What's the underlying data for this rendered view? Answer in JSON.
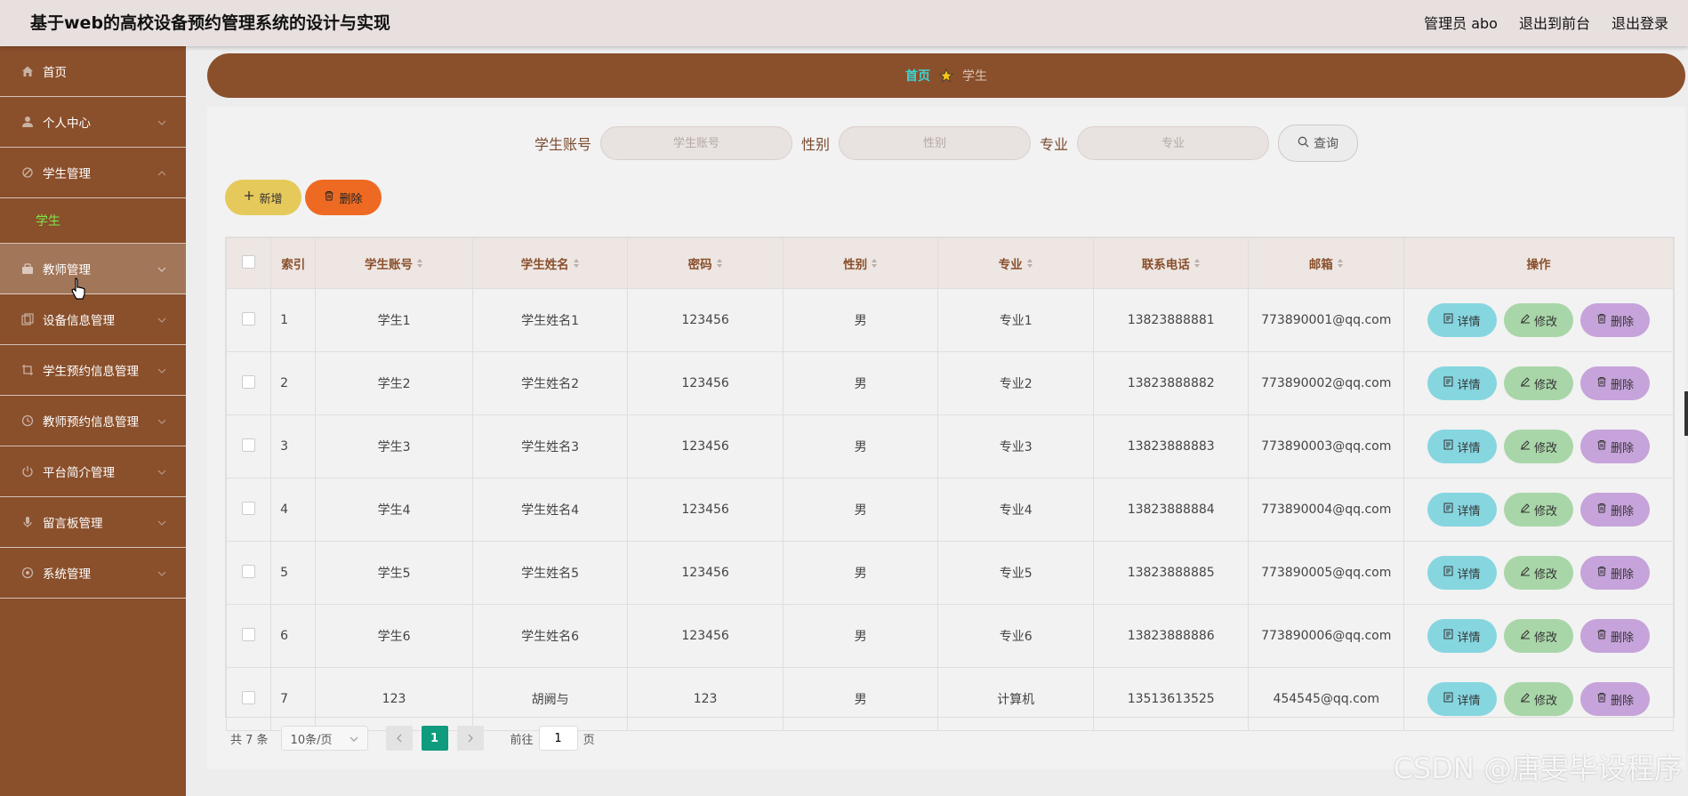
{
  "header": {
    "title": "基于web的高校设备预约管理系统的设计与实现",
    "user": "管理员 abo",
    "front_link": "退出到前台",
    "logout": "退出登录"
  },
  "sidebar": {
    "items": [
      {
        "label": "首页",
        "icon": "home-icon"
      },
      {
        "label": "个人中心",
        "icon": "user-icon"
      },
      {
        "label": "学生管理",
        "icon": "student-icon",
        "expanded": true,
        "sub": [
          "学生"
        ]
      },
      {
        "label": "教师管理",
        "icon": "teacher-icon"
      },
      {
        "label": "设备信息管理",
        "icon": "device-icon"
      },
      {
        "label": "学生预约信息管理",
        "icon": "crop-icon"
      },
      {
        "label": "教师预约信息管理",
        "icon": "clock-icon"
      },
      {
        "label": "平台简介管理",
        "icon": "power-icon"
      },
      {
        "label": "留言板管理",
        "icon": "mic-icon"
      },
      {
        "label": "系统管理",
        "icon": "gear-icon"
      }
    ]
  },
  "breadcrumb": {
    "home": "首页",
    "current": "学生"
  },
  "search": {
    "account_label": "学生账号",
    "account_placeholder": "学生账号",
    "gender_label": "性别",
    "gender_placeholder": "性别",
    "major_label": "专业",
    "major_placeholder": "专业",
    "query_btn": "查询"
  },
  "actions": {
    "add": "新增",
    "delete": "删除"
  },
  "table": {
    "headers": [
      "索引",
      "学生账号",
      "学生姓名",
      "密码",
      "性别",
      "专业",
      "联系电话",
      "邮箱",
      "操作"
    ],
    "rows": [
      [
        "1",
        "学生1",
        "学生姓名1",
        "123456",
        "男",
        "专业1",
        "13823888881",
        "773890001@qq.com"
      ],
      [
        "2",
        "学生2",
        "学生姓名2",
        "123456",
        "男",
        "专业2",
        "13823888882",
        "773890002@qq.com"
      ],
      [
        "3",
        "学生3",
        "学生姓名3",
        "123456",
        "男",
        "专业3",
        "13823888883",
        "773890003@qq.com"
      ],
      [
        "4",
        "学生4",
        "学生姓名4",
        "123456",
        "男",
        "专业4",
        "13823888884",
        "773890004@qq.com"
      ],
      [
        "5",
        "学生5",
        "学生姓名5",
        "123456",
        "男",
        "专业5",
        "13823888885",
        "773890005@qq.com"
      ],
      [
        "6",
        "学生6",
        "学生姓名6",
        "123456",
        "男",
        "专业6",
        "13823888886",
        "773890006@qq.com"
      ],
      [
        "7",
        "123",
        "胡阙与",
        "123",
        "男",
        "计算机",
        "13513613525",
        "454545@qq.com"
      ]
    ],
    "row_ops": {
      "detail": "详情",
      "edit": "修改",
      "delete": "删除"
    }
  },
  "pagination": {
    "total": "共 7 条",
    "page_size": "10条/页",
    "current_page": "1",
    "goto_prefix": "前往",
    "goto_value": "1",
    "goto_suffix": "页"
  },
  "watermark": "CSDN @唐雯毕设程序",
  "colors": {
    "sidebar": "#8a4f2b",
    "accent_green": "#0f9b7d",
    "add_btn": "#e6c95b",
    "del_btn": "#ee6a23"
  }
}
